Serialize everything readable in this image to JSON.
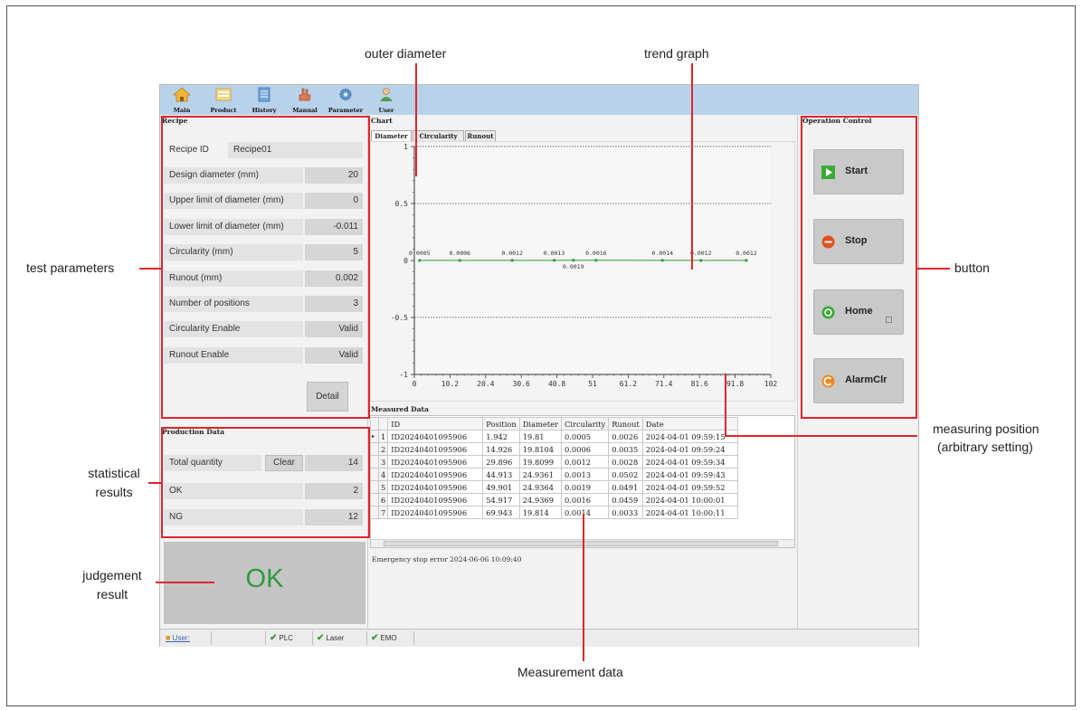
{
  "toolbar": {
    "items": [
      {
        "label": "Main",
        "icon": "home-icon"
      },
      {
        "label": "Product",
        "icon": "product-icon"
      },
      {
        "label": "History",
        "icon": "history-icon"
      },
      {
        "label": "Manual",
        "icon": "hand-icon"
      },
      {
        "label": "Parameter",
        "icon": "gear-icon"
      },
      {
        "label": "User",
        "icon": "user-icon"
      }
    ]
  },
  "recipe": {
    "title": "Recipe",
    "recipe_id_label": "Recipe ID",
    "recipe_id_value": "Recipe01",
    "rows": [
      {
        "label": "Design diameter (mm)",
        "value": "20"
      },
      {
        "label": "Upper limit of diameter (mm)",
        "value": "0"
      },
      {
        "label": "Lower limit of diameter (mm)",
        "value": "-0.011"
      },
      {
        "label": "Circularity (mm)",
        "value": "5"
      },
      {
        "label": "Runout (mm)",
        "value": "0.002"
      },
      {
        "label": "Number of positions",
        "value": "3"
      },
      {
        "label": "Circularity Enable",
        "value": "Valid"
      },
      {
        "label": "Runout Enable",
        "value": "Valid"
      }
    ],
    "detail_button": "Detail"
  },
  "production": {
    "title": "Production Data",
    "total_label": "Total quantity",
    "clear_button": "Clear",
    "total_value": "14",
    "ok_label": "OK",
    "ok_value": "2",
    "ng_label": "NG",
    "ng_value": "12"
  },
  "judgement": {
    "result": "OK",
    "color": "#2e9a3c"
  },
  "chart_panel": {
    "title": "Chart",
    "tabs": [
      "Diameter",
      "Circularity",
      "Runout"
    ],
    "active_tab": "Diameter"
  },
  "chart_data": {
    "type": "line",
    "x_ticks": [
      "0",
      "10.2",
      "20.4",
      "30.6",
      "40.8",
      "51",
      "61.2",
      "71.4",
      "81.6",
      "91.8",
      "102"
    ],
    "y_ticks": [
      "1",
      "0.5",
      "0",
      "-0.5",
      "-1"
    ],
    "ylim": [
      -1,
      1
    ],
    "xlim": [
      0,
      102
    ],
    "grid": true,
    "series": [
      {
        "color": "#2e9a3c",
        "x": [
          1.5,
          13,
          28,
          40,
          45.5,
          52,
          71,
          82,
          95
        ],
        "y": [
          0.0005,
          0.0006,
          0.0012,
          0.0013,
          0.0019,
          0.0016,
          0.0014,
          0.0012,
          0.0012
        ]
      }
    ],
    "point_labels": [
      "0.0005",
      "0.0006",
      "0.0012",
      "0.0013",
      "0.0019",
      "0.0016",
      "0.0014",
      "0.0012",
      "0.0012"
    ]
  },
  "measured": {
    "title": "Measured Data",
    "columns": [
      "ID",
      "Position",
      "Diameter",
      "Circularity",
      "Runout",
      "Date"
    ],
    "rows": [
      {
        "n": "1",
        "id": "ID20240401095906",
        "pos": "1.942",
        "dia": "19.81",
        "circ": "0.0005",
        "run": "0.0026",
        "date": "2024-04-01 09:59:15"
      },
      {
        "n": "2",
        "id": "ID20240401095906",
        "pos": "14.926",
        "dia": "19.8104",
        "circ": "0.0006",
        "run": "0.0035",
        "date": "2024-04-01 09:59:24"
      },
      {
        "n": "3",
        "id": "ID20240401095906",
        "pos": "29.896",
        "dia": "19.8099",
        "circ": "0.0012",
        "run": "0.0028",
        "date": "2024-04-01 09:59:34"
      },
      {
        "n": "4",
        "id": "ID20240401095906",
        "pos": "44.913",
        "dia": "24.9361",
        "circ": "0.0013",
        "run": "0.0502",
        "date": "2024-04-01 09:59:43"
      },
      {
        "n": "5",
        "id": "ID20240401095906",
        "pos": "49.901",
        "dia": "24.9364",
        "circ": "0.0019",
        "run": "0.0491",
        "date": "2024-04-01 09:59:52"
      },
      {
        "n": "6",
        "id": "ID20240401095906",
        "pos": "54.917",
        "dia": "24.9369",
        "circ": "0.0016",
        "run": "0.0459",
        "date": "2024-04-01 10:00:01"
      },
      {
        "n": "7",
        "id": "ID20240401095906",
        "pos": "69.943",
        "dia": "19.814",
        "circ": "0.0014",
        "run": "0.0033",
        "date": "2024-04-01 10:00:11"
      }
    ],
    "error_message": "Emergency stop error  2024-06-06 10:09:40"
  },
  "operation": {
    "title": "Operation Control",
    "buttons": [
      {
        "label": "Start",
        "icon": "play-icon",
        "color": "#3aaa35"
      },
      {
        "label": "Stop",
        "icon": "stop-icon",
        "color": "#e0521e"
      },
      {
        "label": "Home",
        "icon": "home-circle-icon",
        "color": "#3aaa35"
      },
      {
        "label": "AlarmClr",
        "icon": "alarm-clear-icon",
        "color": "#f08a1d"
      }
    ]
  },
  "status": {
    "user": "User:",
    "plc": "PLC",
    "laser": "Laser",
    "emo": "EMO"
  },
  "annotations": {
    "outer_diameter": "outer diameter",
    "trend_graph": "trend graph",
    "test_parameters": "test parameters",
    "button": "button",
    "statistical_results_1": "statistical",
    "statistical_results_2": "results",
    "measuring_position_1": "measuring position",
    "measuring_position_2": "(arbitrary setting)",
    "judgement_result_1": "judgement",
    "judgement_result_2": "result",
    "measurement_data": "Measurement data"
  }
}
